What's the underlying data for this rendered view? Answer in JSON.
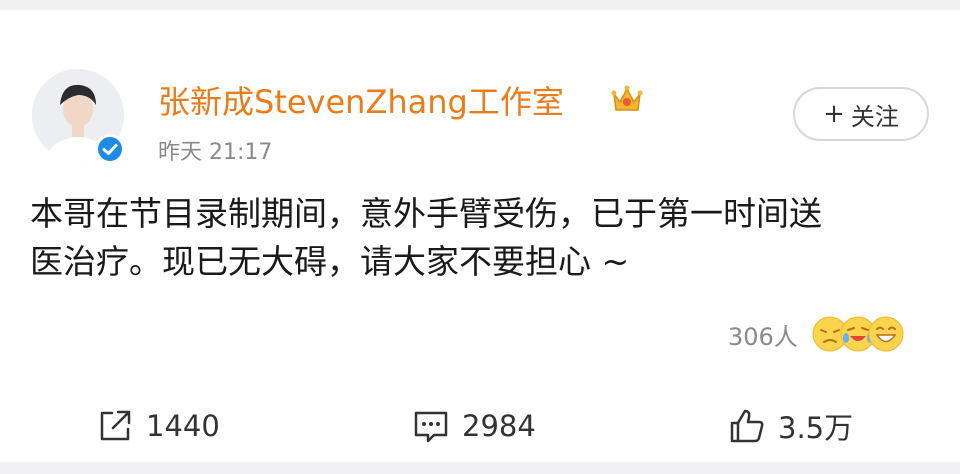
{
  "post": {
    "author": "张新成StevenZhang工作室",
    "time": "昨天 21:17",
    "follow_label": "关注",
    "content_lines": [
      "本哥在节目录制期间，意外手臂受伤，已于第一时间送",
      "医治疗。现已无大碍，请大家不要担心 ~"
    ],
    "reaction_count": "306人",
    "reaction_emojis": [
      "sad-face-emoji",
      "crying-laugh-emoji",
      "laughing-face-emoji"
    ]
  },
  "actions": {
    "repost": "1440",
    "comment": "2984",
    "like": "3.5万"
  },
  "colors": {
    "author_name": "#ec7c1a",
    "verified_badge": "#1e8ce6",
    "muted_text": "#8a8a8a",
    "background": "#f1f1f3"
  }
}
